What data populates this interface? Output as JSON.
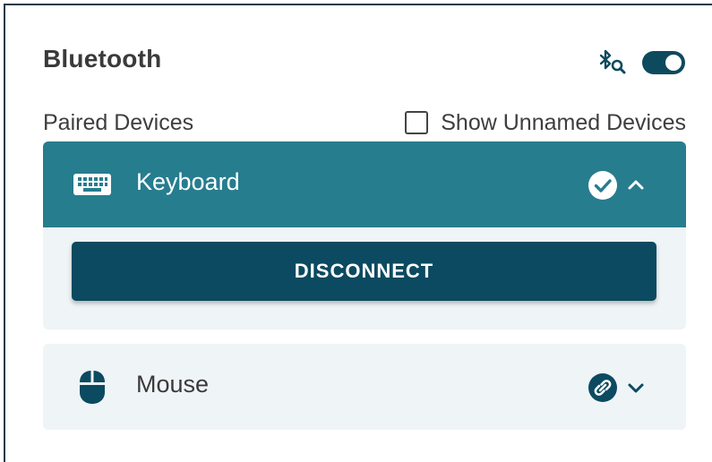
{
  "panel": {
    "title": "Bluetooth",
    "search_icon": "bluetooth-search-icon",
    "bluetooth_enabled": true
  },
  "paired": {
    "label": "Paired Devices",
    "show_unnamed_label": "Show Unnamed Devices",
    "show_unnamed_checked": false
  },
  "devices": [
    {
      "name": "Keyboard",
      "icon": "keyboard-icon",
      "status_icon": "check-circle-icon",
      "expanded": true,
      "action_label": "DISCONNECT"
    },
    {
      "name": "Mouse",
      "icon": "mouse-icon",
      "status_icon": "link-circle-icon",
      "expanded": false
    }
  ],
  "colors": {
    "accent": "#0b4a60",
    "header_active": "#267d8e",
    "card_bg": "#eff4f6",
    "text": "#3a3a3a"
  }
}
